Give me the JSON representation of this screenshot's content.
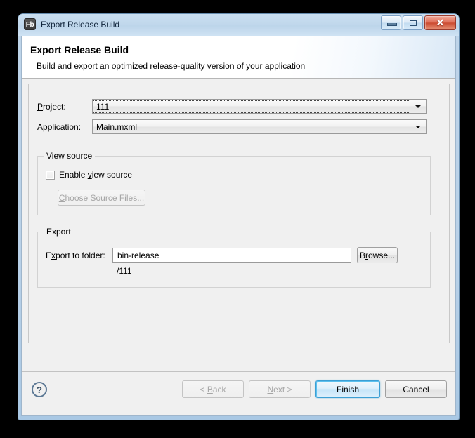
{
  "window": {
    "title": "Export Release Build",
    "app_icon": "Fb",
    "icon_name": "flash-builder-icon",
    "controls": {
      "minimize": "minimize-icon",
      "maximize": "maximize-icon",
      "close": "✕"
    }
  },
  "header": {
    "title": "Export Release Build",
    "subtitle": "Build and export an optimized release-quality version of your application"
  },
  "form": {
    "project": {
      "label_pre": "",
      "label_mnemonic": "P",
      "label_post": "roject:",
      "value": "111",
      "focused": true
    },
    "application": {
      "label_pre": "",
      "label_mnemonic": "A",
      "label_post": "pplication:",
      "value": "Main.mxml",
      "focused": false
    }
  },
  "view_source_group": {
    "title": "View source",
    "checkbox": {
      "label_pre": "Enable ",
      "label_mnemonic": "v",
      "label_post": "iew source",
      "checked": false
    },
    "choose_button": {
      "label_pre": "",
      "label_mnemonic": "C",
      "label_post": "hoose Source Files...",
      "disabled": true
    }
  },
  "export_group": {
    "title": "Export",
    "folder_label_pre": "E",
    "folder_label_mnemonic": "x",
    "folder_label_post": "port to folder:",
    "folder_value": "bin-release",
    "browse_button_pre": "B",
    "browse_button_mnemonic": "r",
    "browse_button_post": "owse...",
    "path_suffix": "/111"
  },
  "footer": {
    "help_glyph": "?",
    "buttons": [
      {
        "label": "< Back",
        "label_pre": "< ",
        "label_mnemonic": "B",
        "label_post": "ack",
        "state": "disabled"
      },
      {
        "label": "Next >",
        "label_pre": "",
        "label_mnemonic": "N",
        "label_post": "ext >",
        "state": "disabled"
      },
      {
        "label": "Finish",
        "label_pre": "",
        "label_mnemonic": "",
        "label_post": "Finish",
        "state": "default"
      },
      {
        "label": "Cancel",
        "label_pre": "",
        "label_mnemonic": "",
        "label_post": "Cancel",
        "state": "normal"
      }
    ]
  },
  "colors": {
    "accent": "#3c9fd4",
    "titlebar": "#c1d8ec",
    "dialog_bg": "#f0f0f0",
    "close_button": "#cb4b32"
  }
}
